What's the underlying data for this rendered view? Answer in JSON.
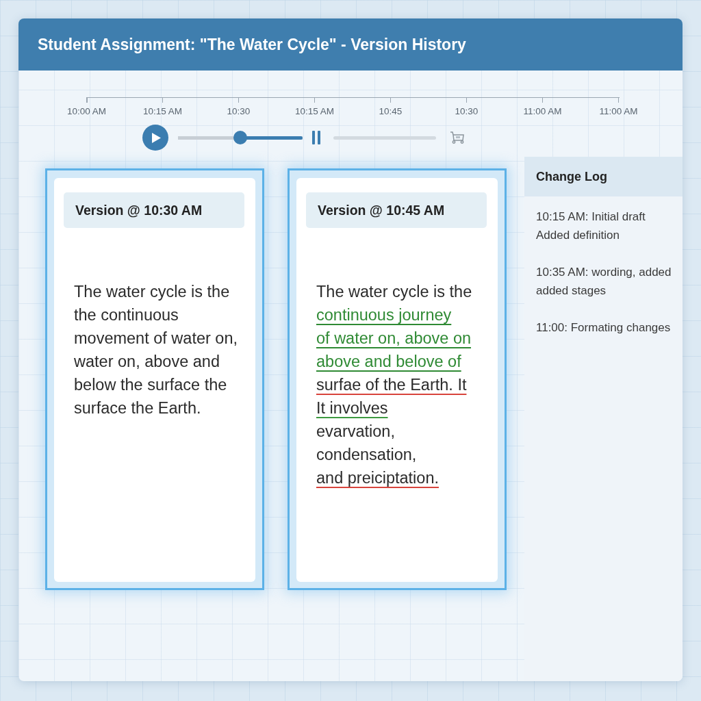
{
  "window": {
    "title": "Student Assignment: \"The Water Cycle\" - Version History"
  },
  "timeline": {
    "ticks": [
      "10:00 AM",
      "10:15 AM",
      "10:30",
      "10:15 AM",
      "10:45",
      "10:30",
      "11:00 AM",
      "11:00 AM"
    ]
  },
  "player": {
    "level": 0.5
  },
  "versions": [
    {
      "title": "Version @ 10:30 AM",
      "lines": [
        {
          "text": "The water cycle is the",
          "kind": "plain"
        },
        {
          "text": "the continuous",
          "kind": "plain"
        },
        {
          "text": "movement of water on,",
          "kind": "plain"
        },
        {
          "text": "water on, above and",
          "kind": "plain"
        },
        {
          "text": "below the surface the",
          "kind": "plain"
        },
        {
          "text": "surface the Earth.",
          "kind": "plain"
        }
      ]
    },
    {
      "title": "Version @ 10:45 AM",
      "lines": [
        {
          "text": "The water cycle is the",
          "kind": "plain"
        },
        {
          "text": "continuous journey",
          "kind": "insert"
        },
        {
          "text": "of water on, above on",
          "kind": "insert"
        },
        {
          "text": "above and belove of",
          "kind": "insert"
        },
        {
          "text": "surfae of the Earth. It",
          "kind": "flagged"
        },
        {
          "text": "It involves",
          "kind": "edited"
        },
        {
          "text": "evarvation,",
          "kind": "plain"
        },
        {
          "text": "condensation,",
          "kind": "plain"
        },
        {
          "text": "and preiciptation.",
          "kind": "flagged"
        }
      ]
    }
  ],
  "change_log": {
    "title": "Change Log",
    "entries": [
      {
        "lines": [
          "10:15 AM: Initial draft",
          "Added definition"
        ]
      },
      {
        "lines": [
          "10:35 AM: wording, added",
          "added stages"
        ]
      },
      {
        "lines": [
          "11:00: Formating changes"
        ]
      }
    ]
  }
}
